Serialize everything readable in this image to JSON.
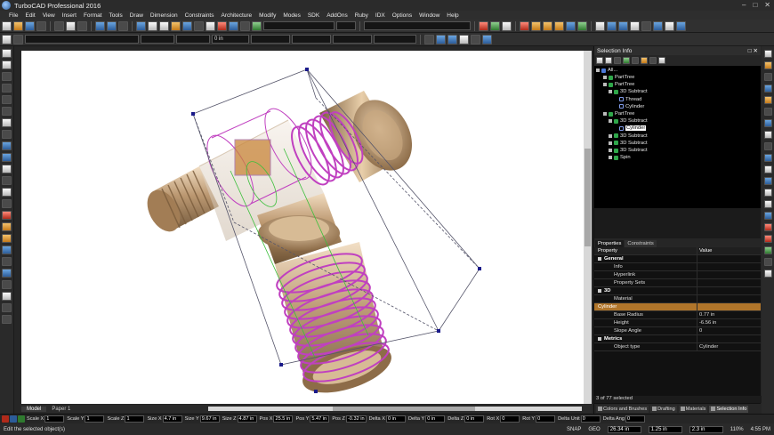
{
  "app": {
    "title": "TurboCAD Professional 2016",
    "logo_icon": "turbocad-logo-icon",
    "window_buttons": [
      "–",
      "□",
      "✕"
    ]
  },
  "menu": [
    "File",
    "Edit",
    "View",
    "Insert",
    "Format",
    "Tools",
    "Draw",
    "Dimension",
    "Constraints",
    "Architecture",
    "Modify",
    "Modes",
    "SDK",
    "AddOns",
    "Ruby",
    "IDX",
    "Options",
    "Window",
    "Help"
  ],
  "toolbar": {
    "thickness_value": "0 in"
  },
  "view_tabs": {
    "model": "Model",
    "paper": "Paper 1"
  },
  "selection_info": {
    "title": "Selection Info",
    "panel_buttons": [
      "□",
      "✕"
    ],
    "all_label": "All...",
    "tree": [
      {
        "label": "PartTree",
        "depth": 1
      },
      {
        "label": "PartTree",
        "depth": 1
      },
      {
        "label": "3D Subtract",
        "depth": 2
      },
      {
        "label": "Thread",
        "depth": 3
      },
      {
        "label": "Cylinder",
        "depth": 3
      },
      {
        "label": "PartTree",
        "depth": 1
      },
      {
        "label": "3D Subtract",
        "depth": 2
      },
      {
        "label": "Cylinder",
        "depth": 3,
        "selected": true
      },
      {
        "label": "3D Subtract",
        "depth": 2
      },
      {
        "label": "3D Subtract",
        "depth": 2
      },
      {
        "label": "3D Subtract",
        "depth": 2
      },
      {
        "label": "Spin",
        "depth": 2
      }
    ],
    "tabs": [
      "Properties",
      "Constraints"
    ],
    "columns": {
      "property": "Property",
      "value": "Value"
    },
    "properties": [
      {
        "name": "General",
        "value": "",
        "type": "group"
      },
      {
        "name": "Info",
        "value": "",
        "type": "item"
      },
      {
        "name": "Hyperlink",
        "value": "",
        "type": "item"
      },
      {
        "name": "Property Sets",
        "value": "",
        "type": "item"
      },
      {
        "name": "3D",
        "value": "",
        "type": "group"
      },
      {
        "name": "Material",
        "value": "",
        "type": "item"
      },
      {
        "name": "Cylinder",
        "value": "",
        "type": "highlight"
      },
      {
        "name": "Base Radius",
        "value": "0.77 in",
        "type": "item"
      },
      {
        "name": "Height",
        "value": "-6.56 in",
        "type": "item"
      },
      {
        "name": "Slope Angle",
        "value": "0",
        "type": "item"
      },
      {
        "name": "Metrics",
        "value": "",
        "type": "group"
      },
      {
        "name": "Object type",
        "value": "Cylinder",
        "type": "item"
      }
    ],
    "status": "3 of 77 selected",
    "bottom_tabs": [
      "Colors and Brushes",
      "Drafting",
      "Materials",
      "Selection Info"
    ]
  },
  "inspector": {
    "fields": [
      {
        "label": "Scale X",
        "value": "1"
      },
      {
        "label": "Scale Y",
        "value": "1"
      },
      {
        "label": "Scale Z",
        "value": "1"
      },
      {
        "label": "Size X",
        "value": "4.7 in"
      },
      {
        "label": "Size Y",
        "value": "9.67 in"
      },
      {
        "label": "Size Z",
        "value": "4.87 in"
      },
      {
        "label": "Pos X",
        "value": "25.5 in"
      },
      {
        "label": "Pos Y",
        "value": "5.47 in"
      },
      {
        "label": "Pos Z",
        "value": "-0.32 in"
      },
      {
        "label": "Delta X",
        "value": "0 in"
      },
      {
        "label": "Delta Y",
        "value": "0 in"
      },
      {
        "label": "Delta Z",
        "value": "0 in"
      },
      {
        "label": "Rot X",
        "value": "0"
      },
      {
        "label": "Rot Y",
        "value": "0"
      },
      {
        "label": "Delta Unit",
        "value": "0"
      },
      {
        "label": "Delta Ang",
        "value": "0"
      }
    ]
  },
  "status": {
    "message": "Edit the selected object(s)",
    "snap": "SNAP",
    "geo": "GEO",
    "x": "26.34 in",
    "y": "1.25 in",
    "z": "2.3 in",
    "zoom": "110%",
    "time": "4:55 PM"
  },
  "colors": {
    "viewport_bg": "#ffffff",
    "highlight": "#b0752a",
    "selection_magenta": "#c040c0",
    "brass": "#b8936a"
  }
}
